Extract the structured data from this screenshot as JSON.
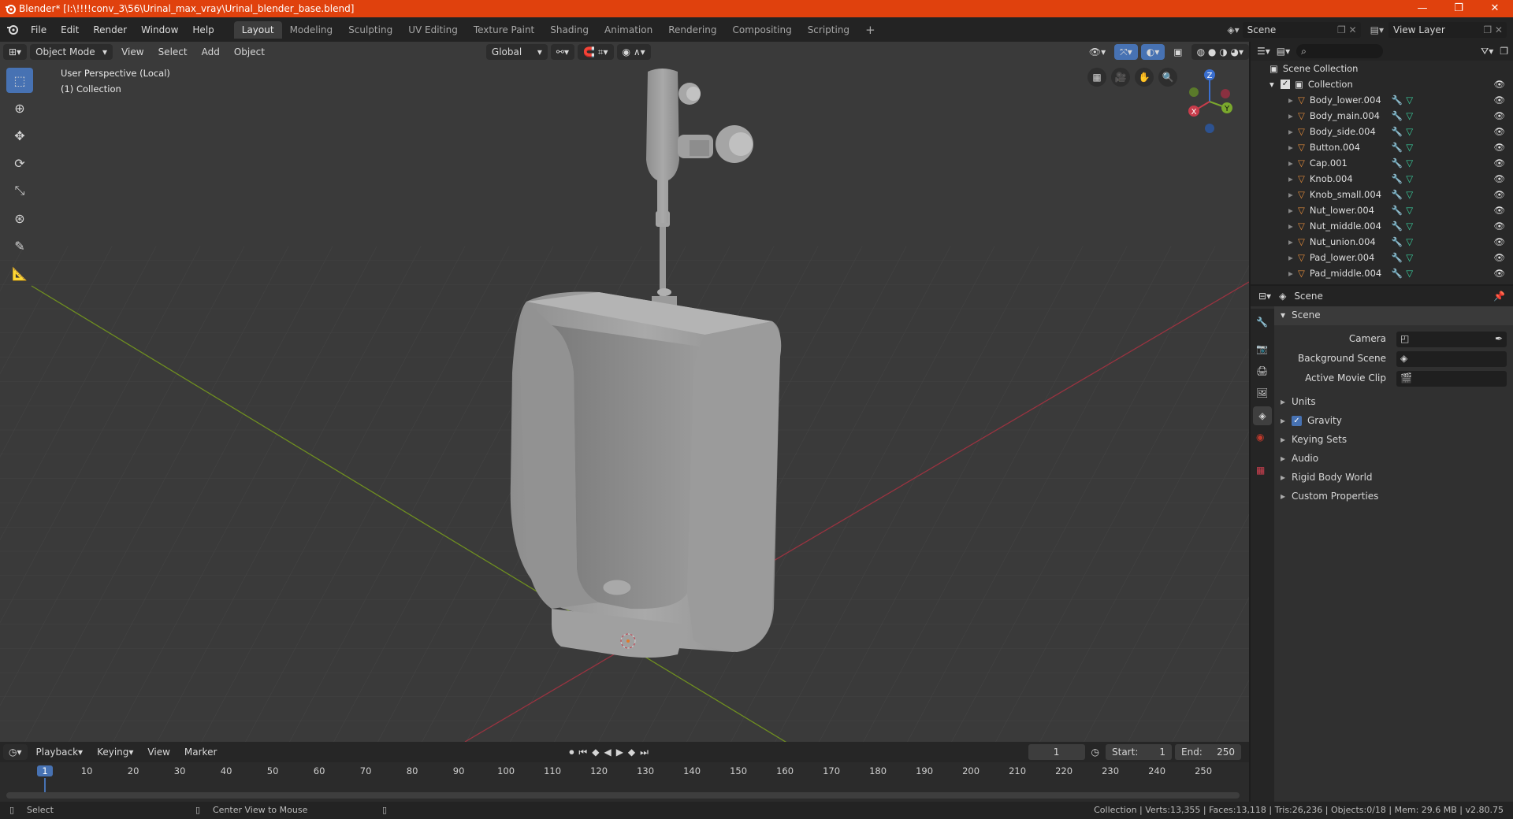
{
  "titlebar": {
    "title": "Blender* [I:\\!!!!conv_3\\56\\Urinal_max_vray\\Urinal_blender_base.blend]",
    "minimize": "—",
    "maximize": "❐",
    "close": "✕"
  },
  "menu": {
    "items": [
      "File",
      "Edit",
      "Render",
      "Window",
      "Help"
    ]
  },
  "workspaces": {
    "tabs": [
      "Layout",
      "Modeling",
      "Sculpting",
      "UV Editing",
      "Texture Paint",
      "Shading",
      "Animation",
      "Rendering",
      "Compositing",
      "Scripting"
    ],
    "active": "Layout",
    "add": "+"
  },
  "scene_selector": {
    "label": "Scene"
  },
  "viewlayer_selector": {
    "label": "View Layer"
  },
  "viewport": {
    "mode": "Object Mode",
    "menus": [
      "View",
      "Select",
      "Add",
      "Object"
    ],
    "orientation": "Global",
    "info_line1": "User Perspective (Local)",
    "info_line2": "(1) Collection",
    "gizmo": {
      "z": "Z",
      "y": "Y",
      "x": "X"
    }
  },
  "outliner": {
    "root": "Scene Collection",
    "collection": "Collection",
    "objects": [
      "Body_lower.004",
      "Body_main.004",
      "Body_side.004",
      "Button.004",
      "Cap.001",
      "Knob.004",
      "Knob_small.004",
      "Nut_lower.004",
      "Nut_middle.004",
      "Nut_union.004",
      "Pad_lower.004",
      "Pad_middle.004"
    ]
  },
  "properties": {
    "context": "Scene",
    "panel_title": "Scene",
    "fields": [
      {
        "label": "Camera"
      },
      {
        "label": "Background Scene"
      },
      {
        "label": "Active Movie Clip"
      }
    ],
    "subpanels": [
      "Units",
      "Gravity",
      "Keying Sets",
      "Audio",
      "Rigid Body World",
      "Custom Properties"
    ],
    "gravity_checked": true
  },
  "timeline": {
    "menus": [
      "Playback",
      "Keying",
      "View",
      "Marker"
    ],
    "current_frame": "1",
    "start_label": "Start:",
    "start": "1",
    "end_label": "End:",
    "end": "250",
    "ruler": [
      "1",
      "10",
      "20",
      "30",
      "40",
      "50",
      "60",
      "70",
      "80",
      "90",
      "100",
      "110",
      "120",
      "130",
      "140",
      "150",
      "160",
      "170",
      "180",
      "190",
      "200",
      "210",
      "220",
      "230",
      "240",
      "250"
    ]
  },
  "status": {
    "left1": "Select",
    "left2": "Center View to Mouse",
    "right": "Collection | Verts:13,355 | Faces:13,118 | Tris:26,236 | Objects:0/18 | Mem: 29.6 MB | v2.80.75"
  },
  "colors": {
    "title_bar": "#e0410d",
    "accent": "#4772b3",
    "x_axis": "#c83c4b",
    "y_axis": "#7aa82d",
    "z_axis": "#3a6fd0"
  }
}
